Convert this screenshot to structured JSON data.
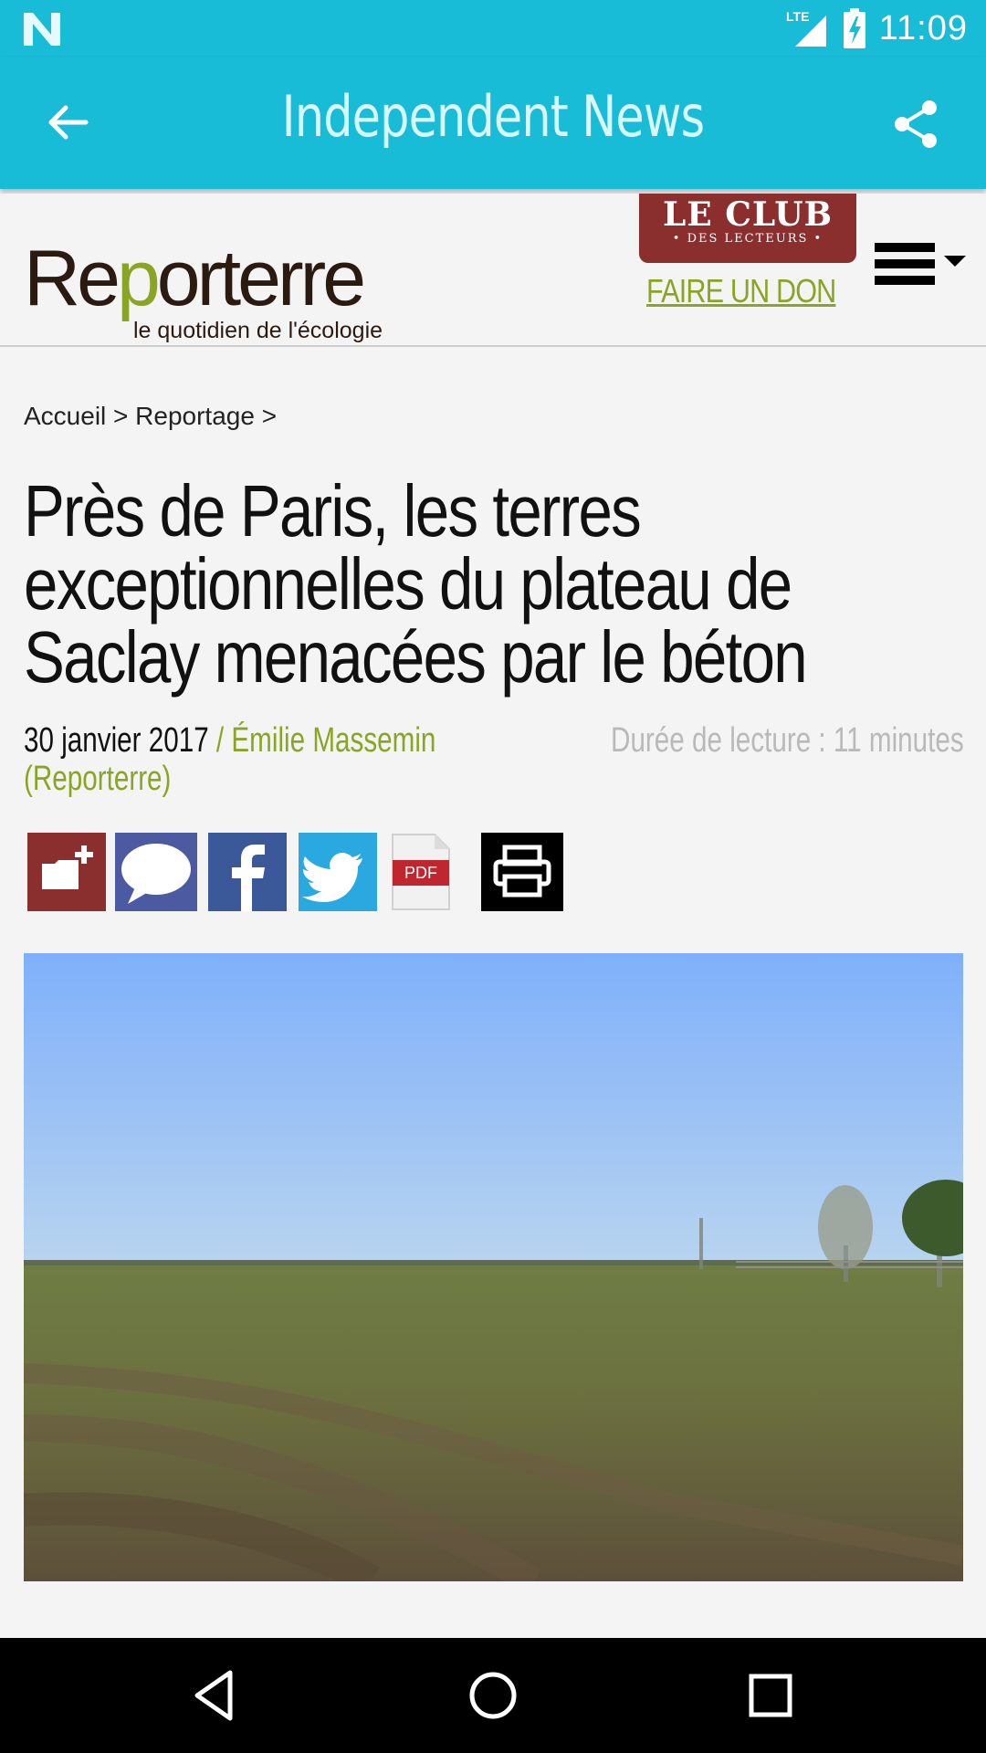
{
  "status_bar": {
    "network": "LTE",
    "time": "11:09",
    "icons": [
      "n-icon",
      "signal-icon",
      "battery-charging-icon"
    ]
  },
  "app_bar": {
    "title": "Independent News",
    "back_icon": "arrow-left-icon",
    "share_icon": "share-icon"
  },
  "site_header": {
    "logo_text": "Reporterre",
    "logo_tagline": "le quotidien de l'écologie",
    "club_title": "LE CLUB",
    "club_subtitle": "• DES LECTEURS •",
    "donate_link": "FAIRE UN DON",
    "menu_icon": "hamburger-menu-icon"
  },
  "breadcrumb": "Accueil > Reportage >",
  "article": {
    "headline": "Près de Paris, les terres exceptionnelles du plateau de Saclay menacées par le béton",
    "date": "30 janvier 2017",
    "author": "/ Émilie Massemin (Reporterre)",
    "reading_time": "Durée de lecture : 11 minutes"
  },
  "share_buttons": [
    {
      "name": "add-to-folder",
      "icon": "folder-add-icon",
      "color": "#8b2e2e"
    },
    {
      "name": "comment",
      "icon": "speech-bubble-icon",
      "color": "#4c5aa2"
    },
    {
      "name": "facebook",
      "icon": "facebook-icon",
      "color": "#3b5998"
    },
    {
      "name": "twitter",
      "icon": "twitter-icon",
      "color": "#2aa9e0"
    },
    {
      "name": "pdf",
      "icon": "pdf-icon",
      "label": "PDF"
    },
    {
      "name": "print",
      "icon": "printer-icon",
      "color": "#000000"
    }
  ],
  "colors": {
    "app_bar": "#19bcd6",
    "accent_green": "#8aa526",
    "club_red": "#8b2e2e"
  },
  "nav_bar": [
    "back-triangle-icon",
    "home-circle-icon",
    "recents-square-icon"
  ]
}
